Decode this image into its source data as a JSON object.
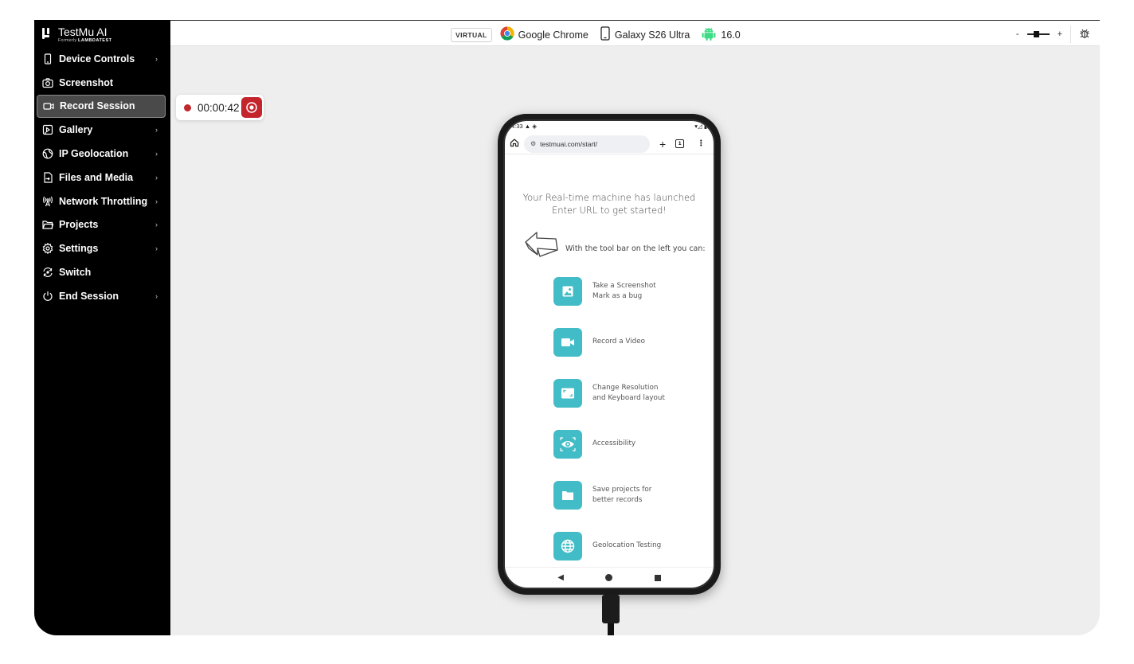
{
  "brand": {
    "name": "TestMu AI",
    "formerly": "Formerly",
    "formerly_brand": "LAMBDATEST"
  },
  "sidebar": {
    "items": [
      {
        "label": "Device Controls",
        "icon": "phone-icon",
        "chevron": "›"
      },
      {
        "label": "Screenshot",
        "icon": "camera-icon",
        "chevron": ""
      },
      {
        "label": "Record Session",
        "icon": "video-icon",
        "chevron": "",
        "active": true
      },
      {
        "label": "Gallery",
        "icon": "gallery-icon",
        "chevron": "›"
      },
      {
        "label": "IP Geolocation",
        "icon": "globe-icon",
        "chevron": "›"
      },
      {
        "label": "Files and Media",
        "icon": "file-upload-icon",
        "chevron": "›"
      },
      {
        "label": "Network Throttling",
        "icon": "antenna-icon",
        "chevron": "›"
      },
      {
        "label": "Projects",
        "icon": "folder-icon",
        "chevron": "›"
      },
      {
        "label": "Settings",
        "icon": "gear-icon",
        "chevron": "›"
      },
      {
        "label": "Switch",
        "icon": "switch-icon",
        "chevron": ""
      },
      {
        "label": "End Session",
        "icon": "power-icon",
        "chevron": "›"
      }
    ]
  },
  "topbar": {
    "badge": "VIRTUAL",
    "browser": "Google Chrome",
    "device": "Galaxy S26 Ultra",
    "os_version": "16.0",
    "zoom_minus": "-",
    "zoom_plus": "+",
    "zoom_level": 0.4
  },
  "recorder": {
    "time": "00:00:42"
  },
  "phone": {
    "status_time": "4:33",
    "url": "testmuai.com/start/",
    "tab_count": "1",
    "headline": "Your Real-time machine has launched Enter URL to get started!",
    "toolbar_line": "With the tool bar on the left you can:",
    "features": [
      {
        "line1": "Take a Screenshot",
        "line2": "Mark as a bug",
        "icon": "image-icon"
      },
      {
        "line1": "Record a Video",
        "line2": "",
        "icon": "video-camera-icon"
      },
      {
        "line1": "Change Resolution",
        "line2": "and Keyboard layout",
        "icon": "resolution-icon"
      },
      {
        "line1": "Accessibility",
        "line2": "",
        "icon": "eye-icon"
      },
      {
        "line1": "Save projects for",
        "line2": "better records",
        "icon": "folder-icon"
      },
      {
        "line1": "Geolocation Testing",
        "line2": "",
        "icon": "globe-icon"
      }
    ]
  },
  "colors": {
    "accent": "#42bcc6",
    "record": "#c4252c",
    "sidebar_bg": "#000000"
  }
}
